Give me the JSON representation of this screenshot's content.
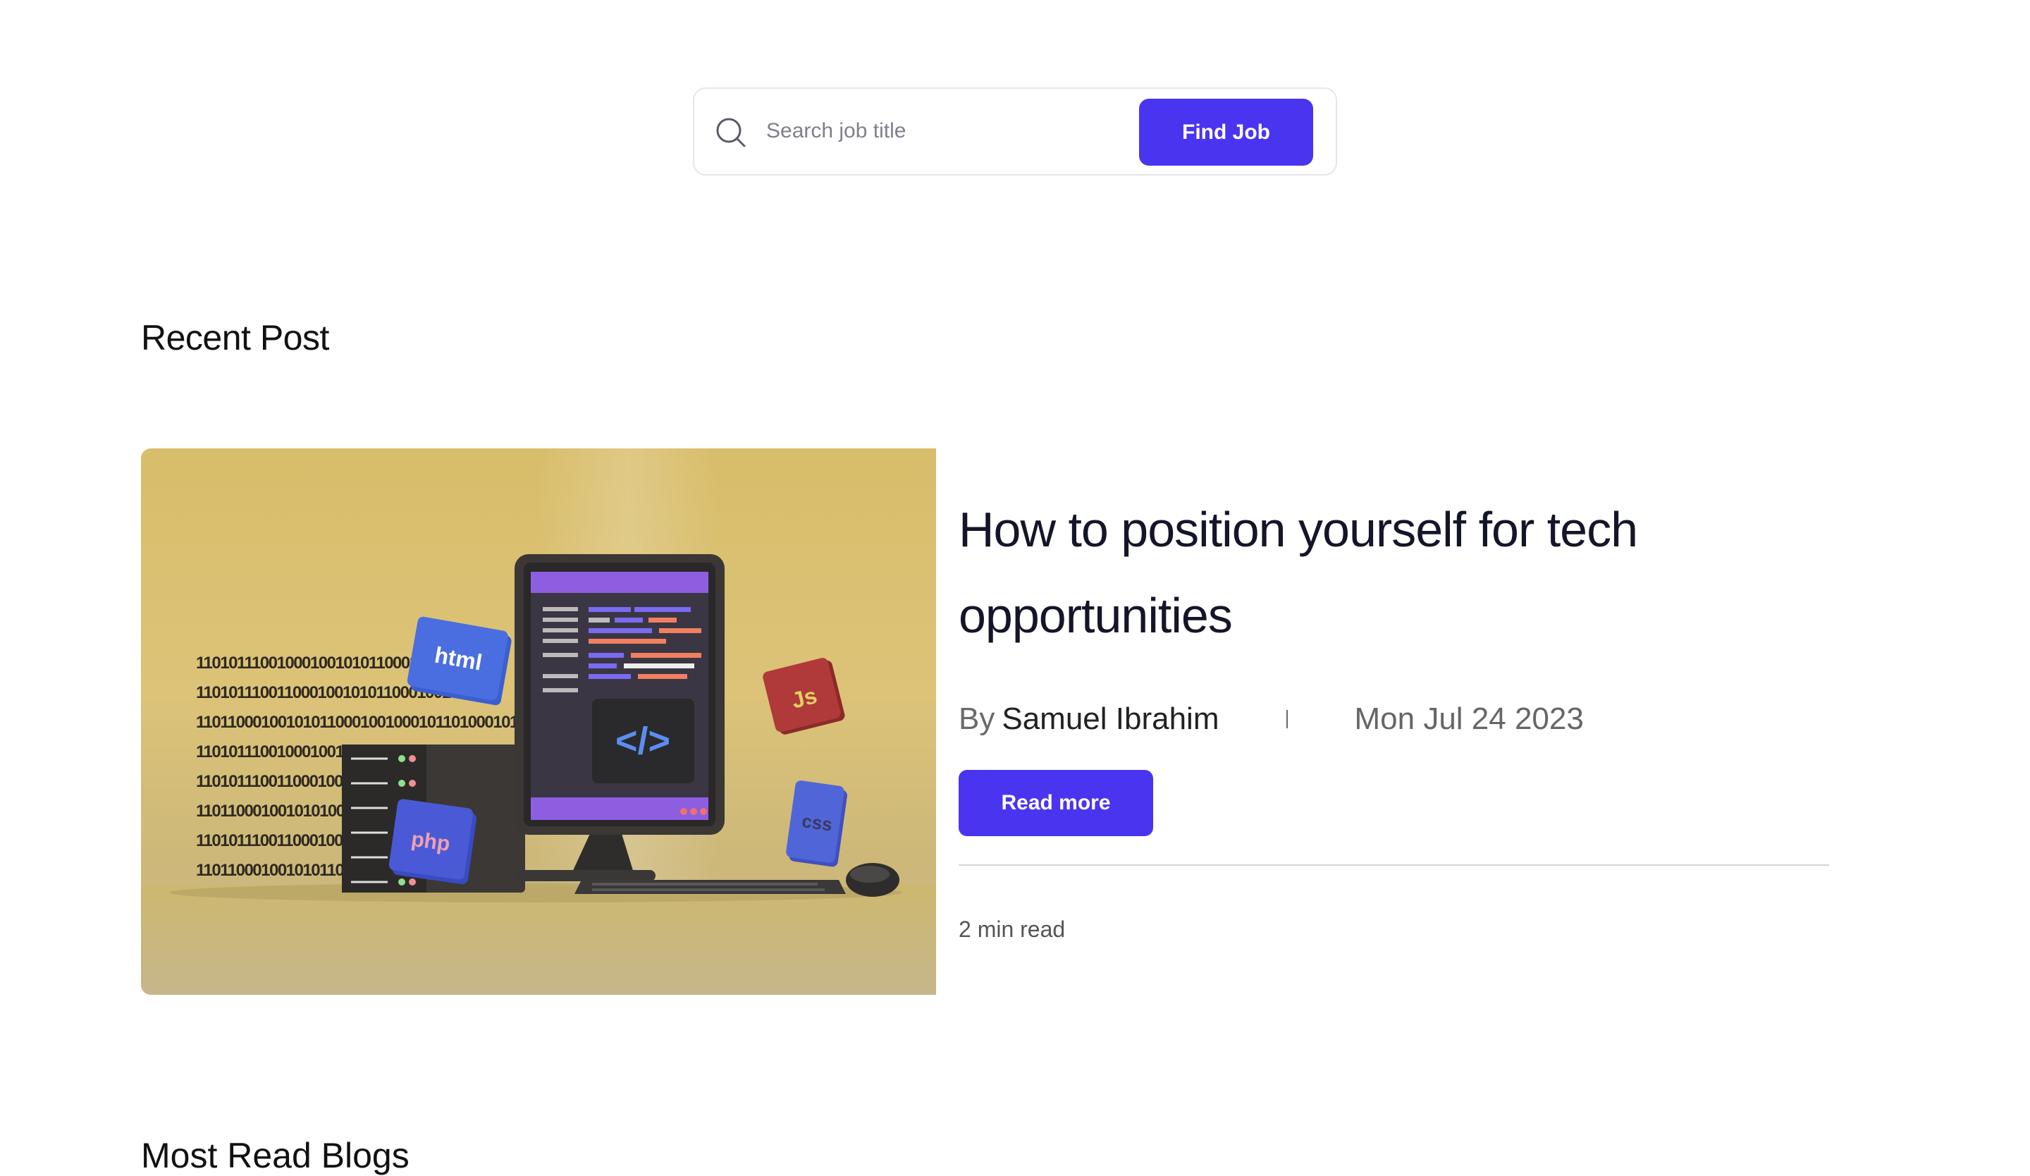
{
  "search": {
    "placeholder": "Search job title",
    "button_label": "Find Job"
  },
  "recent": {
    "section_title": "Recent Post"
  },
  "post": {
    "image_labels": {
      "html": "html",
      "js": "Js",
      "css": "css",
      "php": "php",
      "code_symbol": "</>"
    },
    "binary_lines": [
      "110101110010001001010110001001010010",
      "1101011100110001001010110001001010001",
      "11011000100101011000100100010110100010101101",
      "110101110010001001010",
      "110101110011000100100",
      "1101100010010101000100",
      "1101011100110001001001",
      "110110001001010110001"
    ],
    "title": "How to position yourself for tech opportunities",
    "by_label": "By",
    "author": "Samuel Ibrahim",
    "date": "Mon Jul 24 2023",
    "read_more_label": "Read more",
    "read_time": "2 min read"
  },
  "next_section": {
    "title": "Most Read Blogs"
  },
  "colors": {
    "accent": "#4935f0",
    "image_bg": "#d8bd6a"
  }
}
